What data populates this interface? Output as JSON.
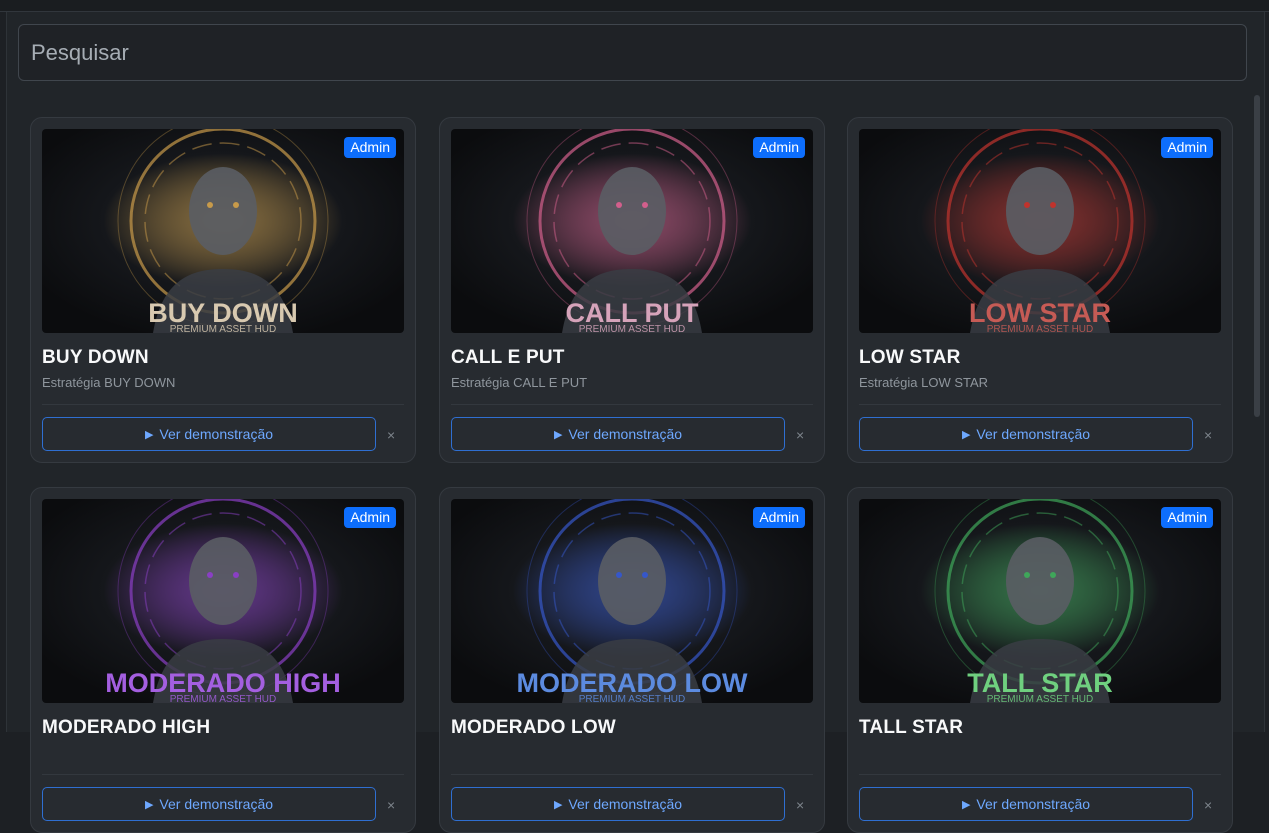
{
  "search": {
    "placeholder": "Pesquisar"
  },
  "demo_label": "Ver demonstração",
  "play_icon": "▶",
  "close_icon": "×",
  "cards": [
    {
      "badge": "Admin",
      "title": "BUY DOWN",
      "subtitle": "Estratégia BUY DOWN",
      "art_title": "BUY DOWN",
      "art_sub": "PREMIUM ASSET HUD",
      "accent": "#c79a4a",
      "art_text_color": "#d8c9b0"
    },
    {
      "badge": "Admin",
      "title": "CALL E PUT",
      "subtitle": "Estratégia CALL E PUT",
      "art_title": "CALL  PUT",
      "art_sub": "PREMIUM ASSET HUD",
      "accent": "#d25f8c",
      "art_text_color": "#d6a3ba"
    },
    {
      "badge": "Admin",
      "title": "LOW STAR",
      "subtitle": "Estratégia LOW STAR",
      "art_title": "LOW STAR",
      "art_sub": "PREMIUM ASSET HUD",
      "accent": "#c0332d",
      "art_text_color": "#c65b55"
    },
    {
      "badge": "Admin",
      "title": "MODERADO HIGH",
      "subtitle": "",
      "art_title": "MODERADO HIGH",
      "art_sub": "PREMIUM ASSET HUD",
      "accent": "#8a3fc4",
      "art_text_color": "#a45fe0"
    },
    {
      "badge": "Admin",
      "title": "MODERADO LOW",
      "subtitle": "",
      "art_title": "MODERADO LOW",
      "art_sub": "PREMIUM ASSET HUD",
      "accent": "#3657c9",
      "art_text_color": "#5c8be0"
    },
    {
      "badge": "Admin",
      "title": "TALL STAR",
      "subtitle": "",
      "art_title": "TALL STAR",
      "art_sub": "PREMIUM ASSET HUD",
      "accent": "#3fa65a",
      "art_text_color": "#6fd07f"
    }
  ]
}
